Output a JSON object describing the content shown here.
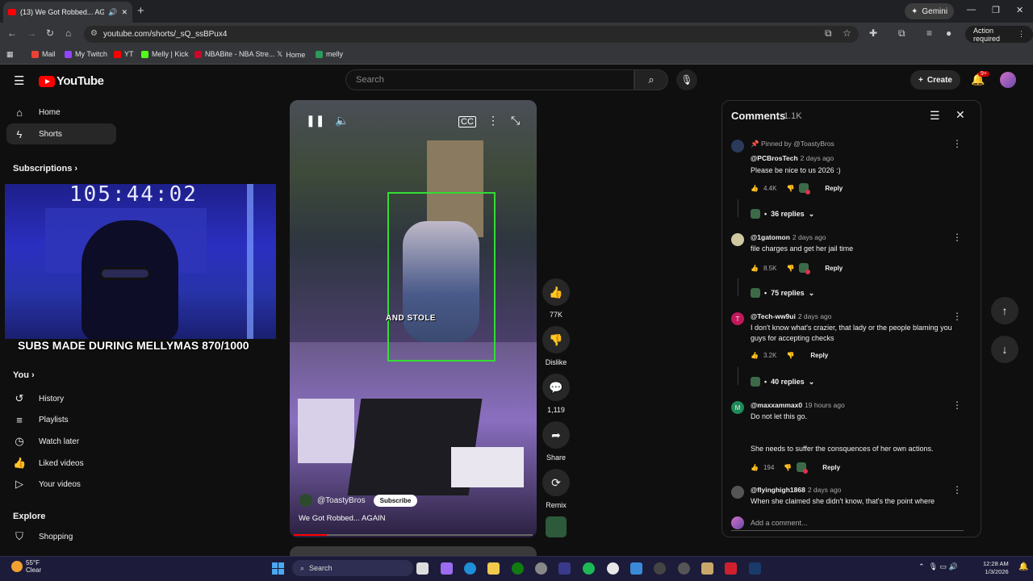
{
  "browser": {
    "tab_title": "(13) We Got Robbed... AGAIN",
    "new_tab": "+",
    "gemini": "Gemini",
    "url": "youtube.com/shorts/_sQ_ssBPux4",
    "action_required": "Action required",
    "bookmarks": [
      "Mail",
      "My Twitch",
      "YT",
      "Melly | Kick",
      "NBABite - NBA Stre...",
      "Home",
      "melly"
    ]
  },
  "header": {
    "logo": "YouTube",
    "search_placeholder": "Search",
    "create_label": "Create",
    "notif_badge": "9+"
  },
  "sidebar": {
    "home": "Home",
    "shorts": "Shorts",
    "subscriptions": "Subscriptions",
    "you": "You",
    "you_items": [
      "History",
      "Playlists",
      "Watch later",
      "Liked videos",
      "Your videos"
    ],
    "explore": "Explore",
    "explore_items": [
      "Shopping"
    ]
  },
  "overlay": {
    "timer": "105:44:02",
    "subs_text": "SUBS MADE DURING MELLYMAS 870/1000"
  },
  "video": {
    "caption": "AND STOLE",
    "channel": "@ToastyBros",
    "subscribe": "Subscribe",
    "title": "We Got Robbed... AGAIN",
    "progress": 0.14
  },
  "actions": {
    "likes": "77K",
    "dislike": "Dislike",
    "comments": "1,119",
    "share": "Share",
    "remix": "Remix"
  },
  "comments": {
    "title": "Comments",
    "count": "1.1K",
    "pinned_by": "Pinned by @ToastyBros",
    "items": [
      {
        "author": "@PCBrosTech",
        "age": "2 days ago",
        "text": "Please be nice to us 2026 :)",
        "likes": "4.4K",
        "replies": "36 replies"
      },
      {
        "author": "@1gatomon",
        "age": "2 days ago",
        "text": "file charges and get her jail time",
        "likes": "8.5K",
        "replies": "75 replies"
      },
      {
        "author": "@Tech-ww9ui",
        "age": "2 days ago",
        "text": "I don't know what's crazier, that lady or the people blaming you guys for accepting checks",
        "likes": "3.2K",
        "replies": "40 replies"
      },
      {
        "author": "@maxxammax0",
        "age": "19 hours ago",
        "text": "Do not let this go.",
        "text2": "She needs to suffer the consquences of her own actions.",
        "likes": "194"
      },
      {
        "author": "@flyinghigh1868",
        "age": "2 days ago",
        "text": "When she claimed she didn't know, that's the point where"
      }
    ],
    "reply_label": "Reply",
    "add_placeholder": "Add a comment..."
  },
  "taskbar": {
    "temp": "55°F",
    "condition": "Clear",
    "search": "Search",
    "time": "12:28 AM",
    "date": "1/3/2026"
  },
  "colors": {
    "yt_red": "#ff0000",
    "bbox_green": "#33dd33",
    "badge_red": "#cc0000"
  }
}
